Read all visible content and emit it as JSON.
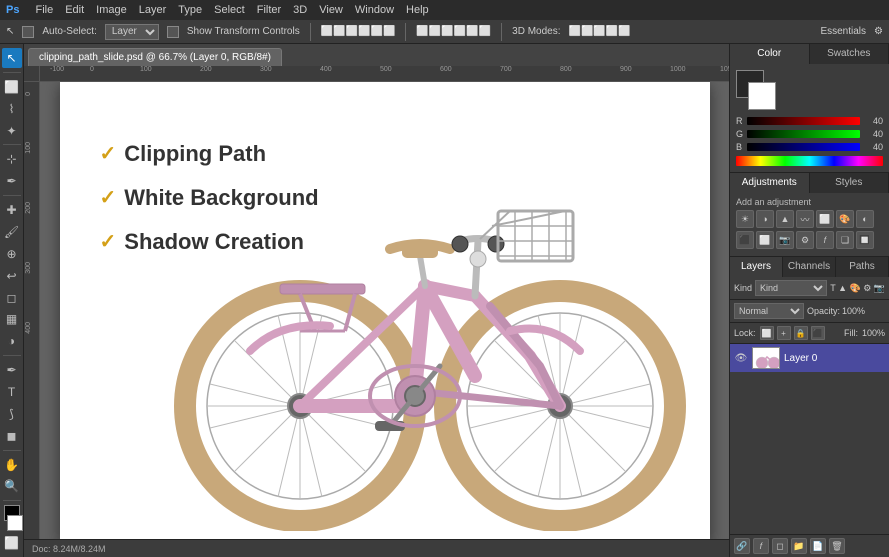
{
  "app": {
    "title": "Adobe Photoshop",
    "logo": "Ps"
  },
  "menu": {
    "items": [
      "File",
      "Edit",
      "Image",
      "Layer",
      "Type",
      "Select",
      "Filter",
      "3D",
      "View",
      "Window",
      "Help"
    ]
  },
  "options_bar": {
    "auto_select_label": "Auto-Select:",
    "auto_select_value": "Layer",
    "transform_label": "Show Transform Controls",
    "workspace": "Essentials"
  },
  "tab": {
    "filename": "clipping_path_slide.psd @ 66.7% (Layer 0, RGB/8#)"
  },
  "canvas": {
    "zoom": "66.7%"
  },
  "features": [
    {
      "text": "Clipping Path"
    },
    {
      "text": "White Background"
    },
    {
      "text": "Shadow Creation"
    }
  ],
  "color_panel": {
    "tabs": [
      "Color",
      "Swatches"
    ],
    "active_tab": "Color",
    "r_value": "40",
    "g_value": "40",
    "b_value": "40"
  },
  "adjustments_panel": {
    "tabs": [
      "Adjustments",
      "Styles"
    ],
    "active_tab": "Adjustments",
    "subtitle": "Add an adjustment",
    "icons": [
      "☀",
      "◑",
      "◐",
      "▲",
      "〰",
      "⬛",
      "🎨",
      "⬜",
      "⚙",
      "𝑓",
      "❏",
      "🔲",
      "📷",
      "📅"
    ]
  },
  "layers_panel": {
    "tabs": [
      "Layers",
      "Channels",
      "Paths"
    ],
    "active_tab": "Layers",
    "kind_label": "Kind",
    "mode": "Normal",
    "opacity_label": "Opacity:",
    "opacity_value": "100%",
    "lock_label": "Lock:",
    "fill_label": "Fill:",
    "fill_value": "100%",
    "layer": {
      "name": "Layer 0",
      "visible": true
    }
  },
  "status_bar": {
    "doc_size": "Doc: 8.24M/8.24M"
  }
}
